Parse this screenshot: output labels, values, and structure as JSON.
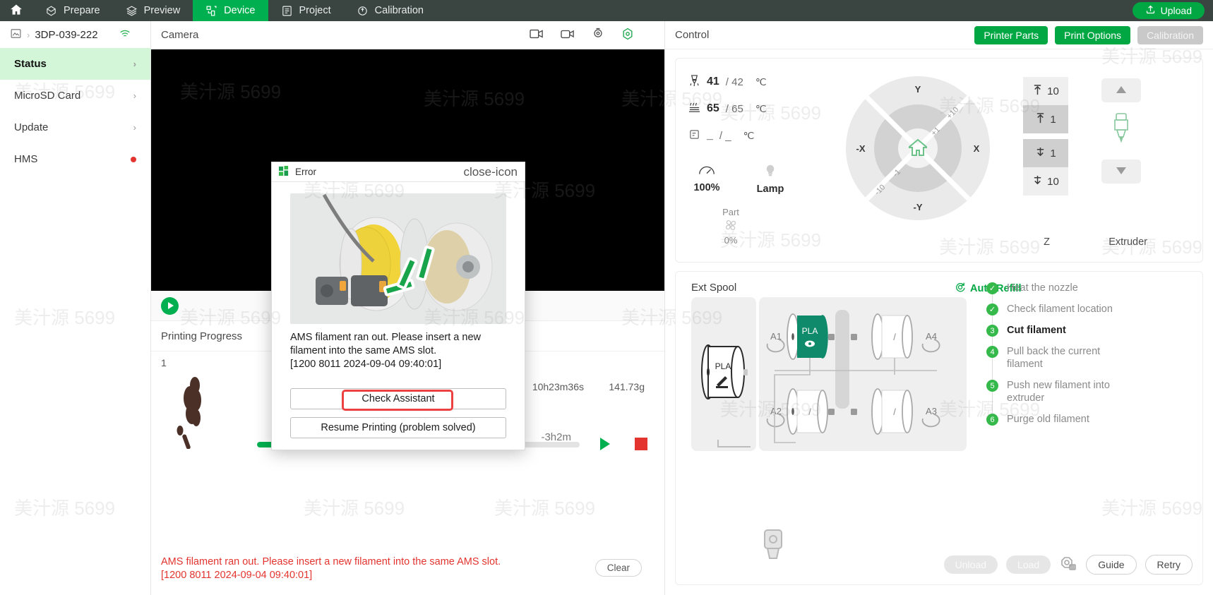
{
  "topnav": {
    "home_icon": "home-icon",
    "items": [
      {
        "label": "Prepare",
        "icon": "prepare-icon",
        "active": false
      },
      {
        "label": "Preview",
        "icon": "preview-layers-icon",
        "active": false
      },
      {
        "label": "Device",
        "icon": "device-icon",
        "active": true
      },
      {
        "label": "Project",
        "icon": "project-list-icon",
        "active": false
      },
      {
        "label": "Calibration",
        "icon": "calibration-icon",
        "active": false
      }
    ],
    "upload_label": "Upload"
  },
  "sidebar": {
    "device_name": "3DP-039-222",
    "device_icon": "printer-box-icon",
    "wifi_icon": "wifi-icon",
    "items": [
      {
        "label": "Status",
        "active": true,
        "badge": "none"
      },
      {
        "label": "MicroSD Card",
        "active": false,
        "badge": "none"
      },
      {
        "label": "Update",
        "active": false,
        "badge": "none"
      },
      {
        "label": "HMS",
        "active": false,
        "badge": "dot"
      }
    ]
  },
  "camera": {
    "title": "Camera",
    "icons": [
      "video-resolution-icon",
      "video-record-icon",
      "timelapse-icon",
      "vision-detect-icon"
    ],
    "play_button": "play-button"
  },
  "progress": {
    "title": "Printing Progress",
    "index": "1",
    "total_time": "10h23m36s",
    "weight": "141.73g",
    "eta": "-3h2m",
    "percent": 70,
    "play_icon": "resume-icon",
    "stop_icon": "stop-icon"
  },
  "error_bar": {
    "line1": "AMS filament ran out. Please insert a new filament into the same AMS slot.",
    "line2": "[1200 8011 2024-09-04 09:40:01]",
    "clear_label": "Clear"
  },
  "control": {
    "title": "Control",
    "buttons": {
      "printer_parts": "Printer Parts",
      "print_options": "Print Options",
      "calibration": "Calibration"
    },
    "temps": [
      {
        "icon": "nozzle-icon",
        "current": "41",
        "target": "/ 42",
        "unit": "℃"
      },
      {
        "icon": "bed-icon",
        "current": "65",
        "target": "/ 65",
        "unit": "℃"
      },
      {
        "icon": "chamber-icon",
        "current": "_",
        "target": "/ _",
        "unit": "℃"
      }
    ],
    "fans": [
      {
        "icon": "speed-gauge-icon",
        "label": "100%"
      },
      {
        "icon": "lamp-icon",
        "label": "Lamp"
      }
    ],
    "part_fan": {
      "caption": "Part",
      "icon": "fan-icon",
      "value": "0%"
    },
    "dial": {
      "home_icon": "home-axis-icon",
      "labels": {
        "up": "Y",
        "down": "-Y",
        "left": "-X",
        "right": "X"
      },
      "steps": {
        "plus10": "+10",
        "plus1": "+1",
        "minus1": "-1",
        "minus10": "-10"
      }
    },
    "z_axis": {
      "label": "Z",
      "buttons": [
        {
          "icon": "arrow-up-top-icon",
          "value": "10",
          "shade": "light"
        },
        {
          "icon": "arrow-up-top-icon",
          "value": "1",
          "shade": "dark"
        },
        {
          "icon": "arrow-down-bottom-icon",
          "value": "1",
          "shade": "dark"
        },
        {
          "icon": "arrow-down-bottom-icon",
          "value": "10",
          "shade": "light"
        }
      ]
    },
    "extruder": {
      "label": "Extruder",
      "up_icon": "triangle-up-icon",
      "down_icon": "triangle-down-icon",
      "nozzle_icon": "extruder-nozzle-icon"
    }
  },
  "ams": {
    "ext_spool_label": "Ext Spool",
    "auto_refill_label": "Auto Refill",
    "auto_refill_icon": "auto-refill-icon",
    "ext_spool": {
      "material": "PLA",
      "icon": "edit-pencil-icon"
    },
    "slots": [
      {
        "id": "A1",
        "material": "PLA",
        "loaded": true,
        "color": "#0f8a6a",
        "icon": "eye-icon"
      },
      {
        "id": "A4",
        "material": "/",
        "loaded": false,
        "color": "#ffffff",
        "icon": "empty-slot-icon"
      },
      {
        "id": "A2",
        "material": "/",
        "loaded": false,
        "color": "#ffffff",
        "icon": "empty-slot-icon"
      },
      {
        "id": "A3",
        "material": "/",
        "loaded": false,
        "color": "#ffffff",
        "icon": "empty-slot-icon"
      }
    ],
    "steps": [
      {
        "num": "✓",
        "label": "Heat the nozzle",
        "state": "done"
      },
      {
        "num": "✓",
        "label": "Check filament location",
        "state": "done"
      },
      {
        "num": "3",
        "label": "Cut filament",
        "state": "current"
      },
      {
        "num": "4",
        "label": "Pull back the current filament",
        "state": "pending"
      },
      {
        "num": "5",
        "label": "Push new filament into extruder",
        "state": "pending"
      },
      {
        "num": "6",
        "label": "Purge old filament",
        "state": "pending"
      }
    ],
    "actions": {
      "unload": "Unload",
      "load": "Load",
      "nozzle_icon": "ams-settings-icon",
      "guide": "Guide",
      "retry": "Retry"
    }
  },
  "modal": {
    "title": "Error",
    "title_icon": "bambu-logo-icon",
    "close_icon": "close-icon",
    "message_line1": "AMS filament ran out. Please insert a new",
    "message_line2": "filament into the same AMS slot.",
    "message_line3": "[1200 8011 2024-09-04 09:40:01]",
    "buttons": {
      "check_assistant": "Check Assistant",
      "resume": "Resume Printing (problem solved)"
    }
  },
  "watermark": {
    "text": "美汁源 5699"
  },
  "colors": {
    "brand_green": "#00a743",
    "nav_bg": "#3a4441",
    "active_nav": "#00b050",
    "sidebar_active": "#d3f5d8",
    "error_red": "#e3342f",
    "highlight_red": "#ec4141",
    "ams_slot_green": "#0f8a6a"
  }
}
